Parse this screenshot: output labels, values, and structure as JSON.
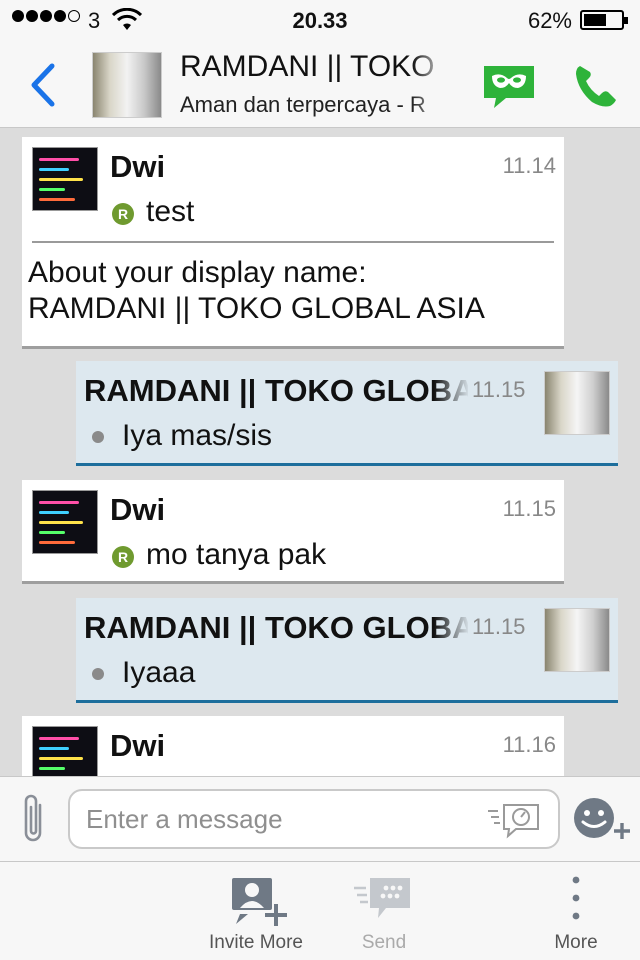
{
  "status_bar": {
    "carrier": "3",
    "time": "20.33",
    "battery": "62%",
    "battery_level": 0.62
  },
  "header": {
    "title": "RAMDANI || TOKO GLOBAL ASIA",
    "subtitle": "Aman dan terpercaya - R",
    "icons": [
      "back-icon",
      "mask-icon",
      "phone-icon"
    ],
    "accent_color": "#1a73e8",
    "green_color": "#2eb33a"
  },
  "messages": [
    {
      "direction": "in",
      "sender": "Dwi",
      "time": "11.14",
      "badge": "R",
      "text": "test",
      "notice_line1": "About your display name:",
      "notice_line2": "RAMDANI || TOKO GLOBAL ASIA"
    },
    {
      "direction": "out",
      "sender": "RAMDANI || TOKO GLOBAL ASIA",
      "time": "11.15",
      "text": "Iya mas/sis"
    },
    {
      "direction": "in",
      "sender": "Dwi",
      "time": "11.15",
      "badge": "R",
      "text": "mo tanya pak"
    },
    {
      "direction": "out",
      "sender": "RAMDANI || TOKO GLOBAL ASIA",
      "time": "11.15",
      "text": "Iyaaa"
    },
    {
      "direction": "in",
      "sender": "Dwi",
      "time": "11.16"
    }
  ],
  "composer": {
    "placeholder": "Enter a message",
    "icons": [
      "paperclip-icon",
      "voice-note-icon",
      "emoji-add-icon"
    ]
  },
  "toolbar": {
    "invite_label": "Invite More",
    "send_label": "Send",
    "more_label": "More"
  }
}
